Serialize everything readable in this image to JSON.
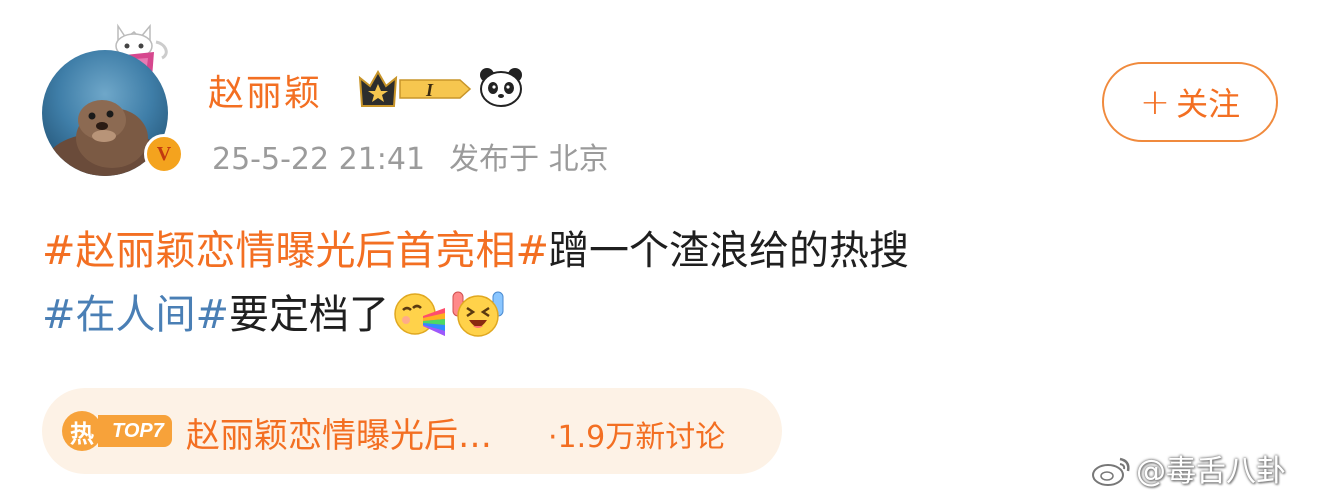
{
  "post": {
    "author": {
      "name": "赵丽颖",
      "vip_level": "I",
      "verified_mark": "V"
    },
    "timestamp": "25-5-22 21:41",
    "location": "发布于 北京",
    "follow_label": "关注",
    "follow_plus": "+",
    "content": {
      "line1_topic": "#赵丽颖恋情曝光后首亮相#",
      "line1_text": "蹭一个渣浪给的热搜",
      "line2_topic": "#在人间#",
      "line2_text": "要定档了",
      "emojis": [
        "rainbow-vomit-emoji",
        "excited-face-emoji"
      ]
    },
    "trend": {
      "hot_label": "热",
      "rank_label": "TOP7",
      "title": "赵丽颖恋情曝光后…",
      "count": "·1.9万新讨论"
    }
  },
  "watermark": {
    "text": "@毒舌八卦",
    "icon": "weibo-logo-icon"
  },
  "colors": {
    "accent_orange": "#f36f22",
    "topic_blue": "#4a7fb5",
    "meta_gray": "#9b9b9b",
    "trend_bg": "#fdf2e6"
  }
}
